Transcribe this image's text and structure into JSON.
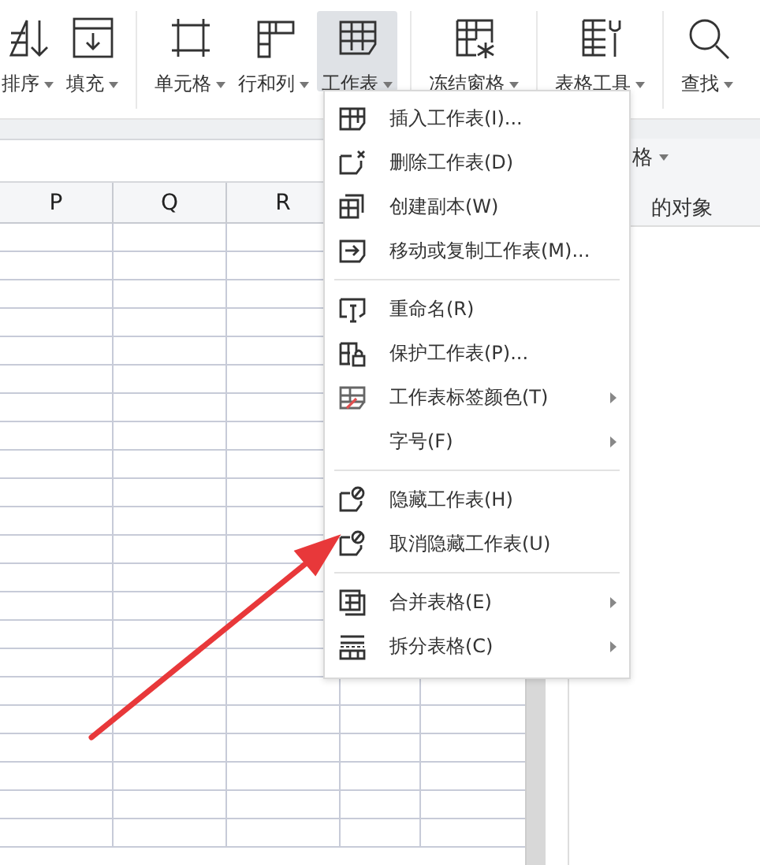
{
  "toolbar": [
    {
      "label": "排序",
      "selected": false
    },
    {
      "label": "填充",
      "selected": false
    },
    {
      "label": "单元格",
      "selected": false
    },
    {
      "label": "行和列",
      "selected": false
    },
    {
      "label": "工作表",
      "selected": true
    },
    {
      "label": "冻结窗格",
      "selected": false
    },
    {
      "label": "表格工具",
      "selected": false
    },
    {
      "label": "查找",
      "selected": false
    }
  ],
  "sheet": {
    "columns": [
      "P",
      "Q",
      "R"
    ]
  },
  "side_panel": {
    "title": "格",
    "subtitle": "的对象"
  },
  "menu": [
    {
      "label": "插入工作表(I)...",
      "submenu": false
    },
    {
      "label": "删除工作表(D)",
      "submenu": false
    },
    {
      "label": "创建副本(W)",
      "submenu": false
    },
    {
      "label": "移动或复制工作表(M)...",
      "submenu": false,
      "divider_after": true
    },
    {
      "label": "重命名(R)",
      "submenu": false
    },
    {
      "label": "保护工作表(P)...",
      "submenu": false
    },
    {
      "label": "工作表标签颜色(T)",
      "submenu": true
    },
    {
      "label": "字号(F)",
      "submenu": true,
      "divider_after": true
    },
    {
      "label": "隐藏工作表(H)",
      "submenu": false
    },
    {
      "label": "取消隐藏工作表(U)",
      "submenu": false,
      "divider_after": true
    },
    {
      "label": "合并表格(E)",
      "submenu": true
    },
    {
      "label": "拆分表格(C)",
      "submenu": true
    }
  ],
  "annotation": {
    "kind": "arrow",
    "color": "#e8383a"
  }
}
